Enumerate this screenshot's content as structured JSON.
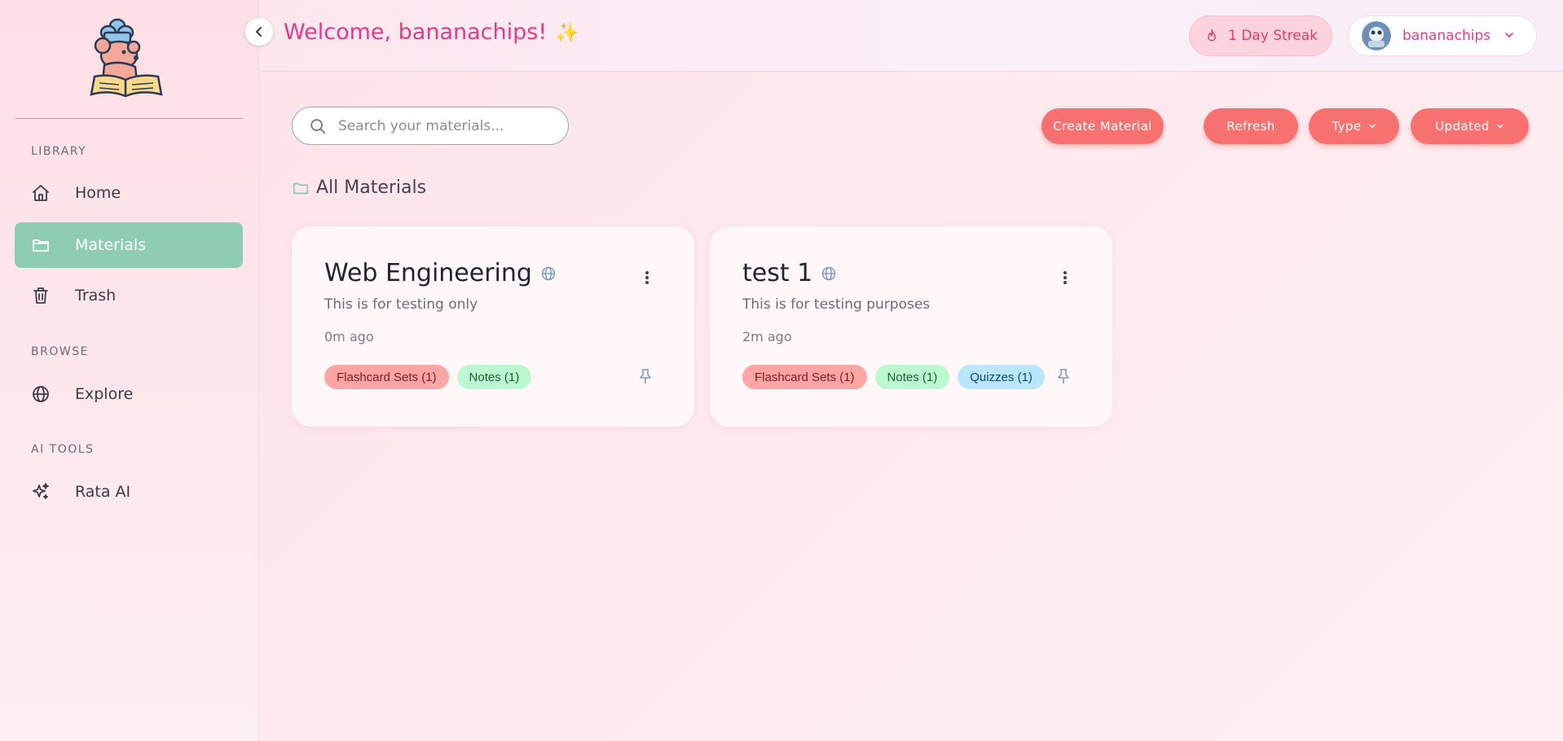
{
  "sidebar": {
    "library_label": "LIBRARY",
    "browse_label": "BROWSE",
    "ai_tools_label": "AI TOOLS",
    "items": [
      {
        "label": "Home",
        "icon": "home-icon"
      },
      {
        "label": "Materials",
        "icon": "folder-icon",
        "active": true
      },
      {
        "label": "Trash",
        "icon": "trash-icon"
      },
      {
        "label": "Explore",
        "icon": "globe-icon"
      },
      {
        "label": "Rata AI",
        "icon": "sparkles-icon"
      }
    ]
  },
  "header": {
    "welcome": "Welcome, bananachips!",
    "sparkle": "✨",
    "streak": "1 Day Streak",
    "username": "bananachips"
  },
  "toolbar": {
    "search_placeholder": "Search your materials...",
    "create_label": "Create Material",
    "refresh_label": "Refresh",
    "type_label": "Type",
    "updated_label": "Updated"
  },
  "section": {
    "title": "All Materials"
  },
  "materials": [
    {
      "title": "Web Engineering",
      "description": "This is for testing only",
      "time": "0m ago",
      "tags": [
        "Flashcard Sets (1)",
        "Notes (1)"
      ]
    },
    {
      "title": "test 1",
      "description": "This is for testing purposes",
      "time": "2m ago",
      "tags": [
        "Flashcard Sets (1)",
        "Notes (1)",
        "Quizzes (1)"
      ]
    }
  ],
  "colors": {
    "accent_pink": "#e23b8a",
    "button_red": "#f87171",
    "active_nav": "#8ecdb2"
  }
}
